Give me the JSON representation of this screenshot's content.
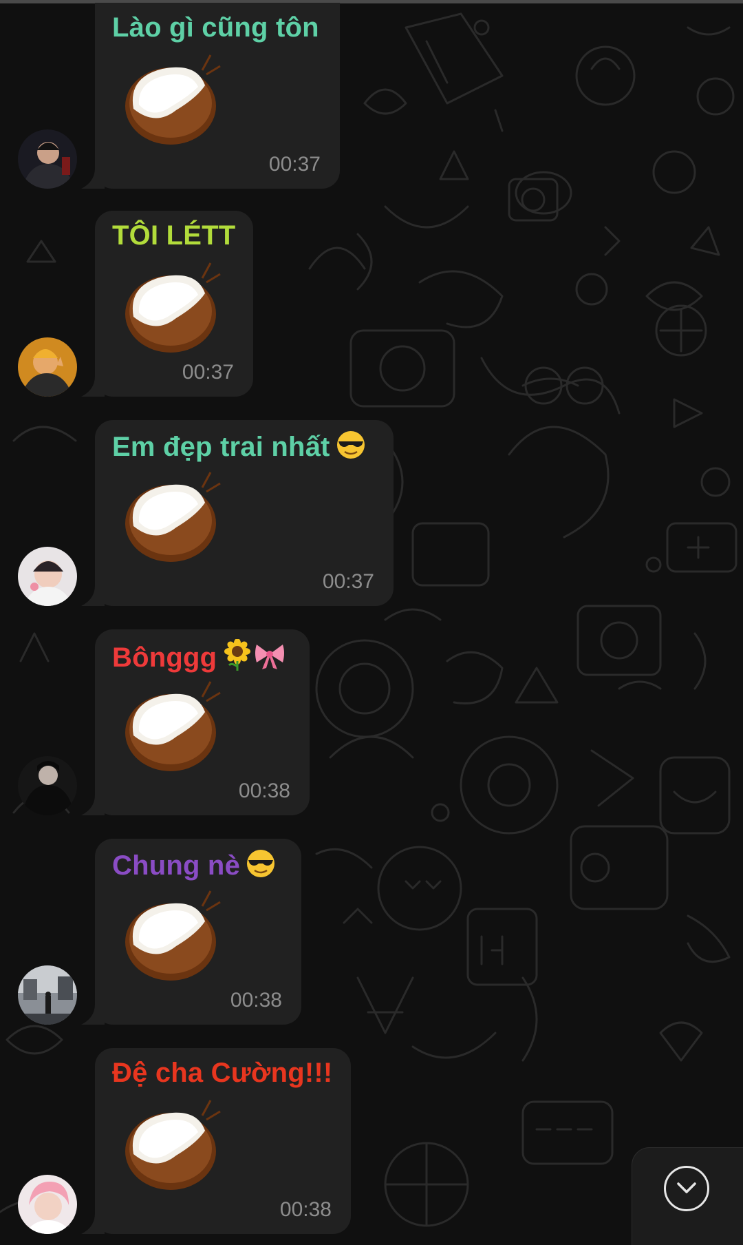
{
  "chat": {
    "messages": [
      {
        "sender": "Lào gì cũng tôn",
        "sender_color": "#5ed0a6",
        "emoji": "",
        "sticker": "coconut",
        "time": "00:37",
        "avatar": "avatar-dark-jacket"
      },
      {
        "sender": "TÔI LÉTT",
        "sender_color": "#b2dc3b",
        "emoji": "",
        "sticker": "coconut",
        "time": "00:37",
        "avatar": "avatar-orange"
      },
      {
        "sender": "Em đẹp trai nhất",
        "sender_color": "#5ed0a6",
        "emoji": "sunglasses",
        "sticker": "coconut",
        "time": "00:37",
        "avatar": "avatar-selfie"
      },
      {
        "sender": "Bônggg",
        "sender_color": "#ee3a3a",
        "emoji": "sunflower-bow",
        "sticker": "coconut",
        "time": "00:38",
        "avatar": "avatar-black-hoodie"
      },
      {
        "sender": "Chung nè",
        "sender_color": "#8a4cc4",
        "emoji": "sunglasses",
        "sticker": "coconut",
        "time": "00:38",
        "avatar": "avatar-street"
      },
      {
        "sender": "Đệ cha Cường!!!",
        "sender_color": "#e8361f",
        "emoji": "",
        "sticker": "coconut",
        "time": "00:38",
        "avatar": "avatar-pink-hair"
      }
    ]
  },
  "scroll_button": {
    "icon": "chevron-down-icon"
  }
}
